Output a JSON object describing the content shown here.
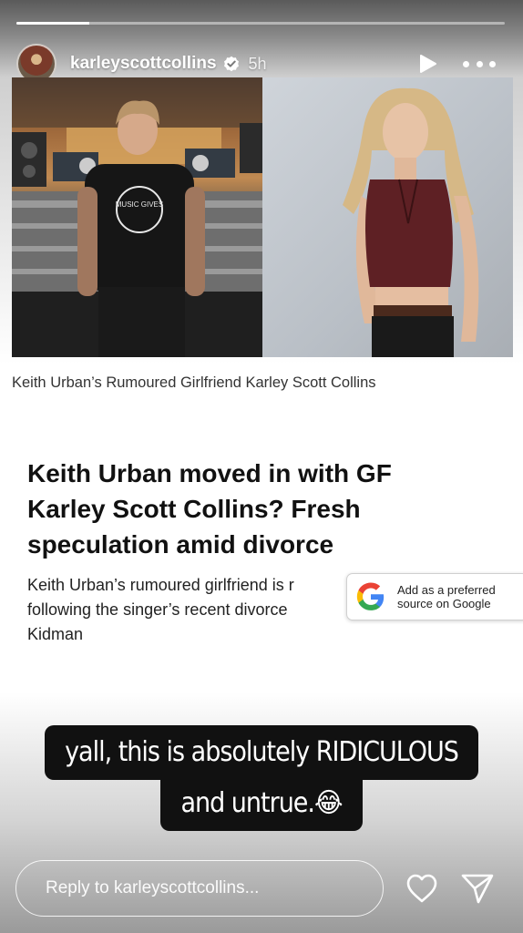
{
  "story": {
    "progress_fraction": 0.15,
    "username": "karleyscottcollins",
    "time_ago": "5h",
    "verified": true
  },
  "article": {
    "photo_left_icon": "man-at-mixing-console-photo",
    "photo_right_icon": "woman-in-leather-vest-photo",
    "shirt_text": "MUSIC GIVES",
    "caption": "Keith Urban’s Rumoured Girlfriend Karley Scott Collins",
    "headline_lines": [
      "Keith Urban moved in with GF",
      "Karley Scott Collins? Fresh",
      "speculation amid divorce"
    ],
    "body_lines": [
      "Keith Urban’s rumoured girlfriend is r",
      "following the singer’s recent divorce",
      "Kidman"
    ],
    "google_chip": {
      "line1": "Add as a preferred",
      "line2": "source on Google"
    }
  },
  "overlay": {
    "line1": "yall, this is absolutely RIDICULOUS",
    "line2": "and untrue.😂"
  },
  "reply": {
    "placeholder": "Reply to karleyscottcollins..."
  },
  "colors": {
    "google_blue": "#4285F4",
    "google_red": "#EA4335",
    "google_yellow": "#FBBC05",
    "google_green": "#34A853",
    "verified_blue": "#ffffff"
  }
}
